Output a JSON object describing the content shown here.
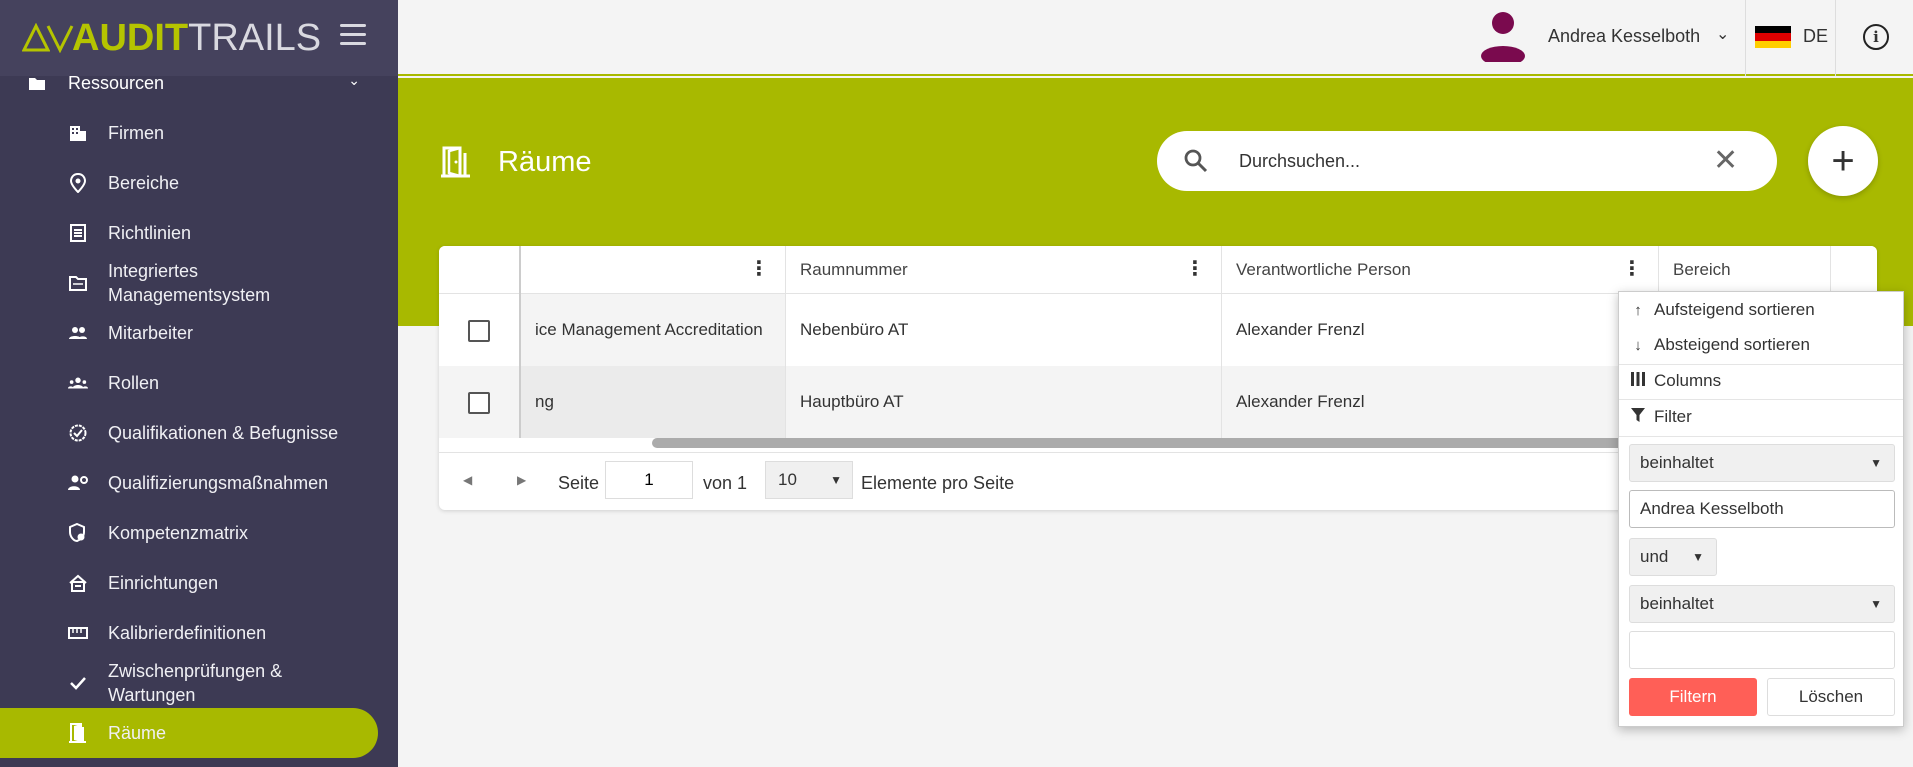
{
  "sidebar": {
    "logo_part1": "AUDIT",
    "logo_part2": "TRAILS",
    "group_label": "Ressourcen",
    "items": [
      {
        "label": "Firmen",
        "icon": "building-icon"
      },
      {
        "label": "Bereiche",
        "icon": "location-pin-icon"
      },
      {
        "label": "Richtlinien",
        "icon": "list-document-icon"
      },
      {
        "label": "Integriertes\nManagementsystem",
        "icon": "folder-icon"
      },
      {
        "label": "Mitarbeiter",
        "icon": "people-icon"
      },
      {
        "label": "Rollen",
        "icon": "group-icon"
      },
      {
        "label": "Qualifikationen & Befugnisse",
        "icon": "badge-check-icon"
      },
      {
        "label": "Qualifizierungsmaßnahmen",
        "icon": "person-gear-icon"
      },
      {
        "label": "Kompetenzmatrix",
        "icon": "shield-gear-icon"
      },
      {
        "label": "Einrichtungen",
        "icon": "home-icon"
      },
      {
        "label": "Kalibrierdefinitionen",
        "icon": "ruler-icon"
      },
      {
        "label": "Zwischenprüfungen &\nWartungen",
        "icon": "checkmark-icon"
      },
      {
        "label": "Räume",
        "icon": "door-icon",
        "active": true
      }
    ]
  },
  "topbar": {
    "user_name": "Andrea Kesselboth",
    "language": "DE",
    "accent_color": "#a8b900"
  },
  "page": {
    "title": "Räume",
    "search_placeholder": "Durchsuchen...",
    "search_value": ""
  },
  "table": {
    "columns": [
      "",
      "Raumnummer",
      "Verantwortliche Person",
      "Bereich"
    ],
    "rows": [
      {
        "name": "ice Management Accreditation",
        "room": "Nebenbüro AT",
        "person": "Alexander Frenzl"
      },
      {
        "name": "ng",
        "room": "Hauptbüro AT",
        "person": "Alexander Frenzl"
      }
    ]
  },
  "pager": {
    "seite_label": "Seite",
    "page": "1",
    "von_label": "von 1",
    "per_page": "10",
    "per_page_label": "Elemente pro Seite"
  },
  "column_menu": {
    "sort_asc": "Aufsteigend sortieren",
    "sort_desc": "Absteigend sortieren",
    "columns": "Columns",
    "filter": "Filter",
    "operator1": "beinhaltet",
    "value1": "Andrea Kesselboth",
    "join": "und",
    "operator2": "beinhaltet",
    "value2": "",
    "apply": "Filtern",
    "clear": "Löschen",
    "apply_color": "#ff5f57"
  }
}
